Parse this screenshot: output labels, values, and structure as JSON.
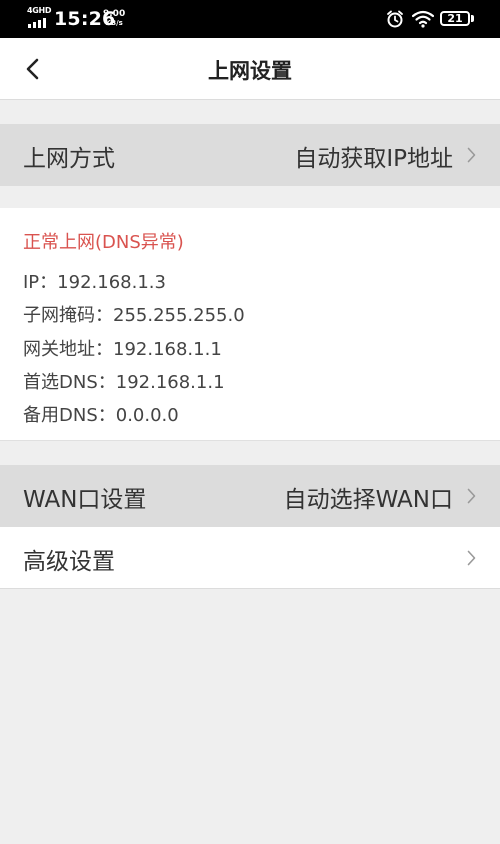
{
  "status_bar": {
    "network_type": "4GHD",
    "time": "15:26",
    "speed_value": "9.00",
    "speed_unit": "KB/s",
    "battery": "21"
  },
  "header": {
    "title": "上网设置"
  },
  "connection_mode": {
    "label": "上网方式",
    "value": "自动获取IP地址"
  },
  "info": {
    "status": "正常上网(DNS异常)",
    "lines": [
      "IP：192.168.1.3",
      "子网掩码：255.255.255.0",
      "网关地址：192.168.1.1",
      "首选DNS：192.168.1.1",
      "备用DNS：0.0.0.0"
    ]
  },
  "wan": {
    "label": "WAN口设置",
    "value": "自动选择WAN口"
  },
  "advanced": {
    "label": "高级设置"
  },
  "colors": {
    "status_error": "#d9534f",
    "row_highlight": "#dcdcdc",
    "background": "#efefef"
  },
  "icons": [
    "4g-signal-icon",
    "alarm-icon",
    "wifi-icon",
    "battery-icon",
    "back-arrow-icon",
    "chevron-right-icon"
  ]
}
